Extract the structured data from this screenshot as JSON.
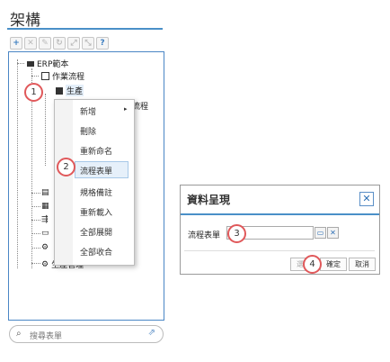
{
  "panel": {
    "title": "架構"
  },
  "toolbar": {
    "buttons": [
      {
        "name": "add-icon",
        "glyph": "+"
      },
      {
        "name": "delete-icon",
        "glyph": "✕"
      },
      {
        "name": "edit-icon",
        "glyph": "✎"
      },
      {
        "name": "refresh-icon",
        "glyph": "↻"
      },
      {
        "name": "expand-icon",
        "glyph": "⤢"
      },
      {
        "name": "collapse-icon",
        "glyph": "⤡"
      },
      {
        "name": "help-icon",
        "glyph": "?"
      }
    ]
  },
  "tree": {
    "root": "ERP範本",
    "workflow": "作業流程",
    "production": "生產",
    "behind_fragment": "流程",
    "bottom_item": "生產管理"
  },
  "context_menu": {
    "items": [
      "新增",
      "刪除",
      "重新命名",
      "流程表單",
      "規格備註",
      "重新載入",
      "全部展開",
      "全部收合"
    ],
    "submenu_arrow": "▸"
  },
  "search": {
    "placeholder": "搜尋表單",
    "search_icon": "search-icon",
    "open_icon": "external-link-icon"
  },
  "dialog": {
    "title": "資料呈現",
    "close": "✕",
    "field_label": "流程表單",
    "field_value": "",
    "browse_icon": "folder-icon",
    "clear_icon": "clear-icon",
    "buttons": {
      "confirm": "確定",
      "cancel": "取消",
      "partial": "選"
    }
  },
  "steps": [
    "1",
    "2",
    "3",
    "4"
  ],
  "colors": {
    "accent": "#4a90c8",
    "step_ring": "#e0585a"
  }
}
